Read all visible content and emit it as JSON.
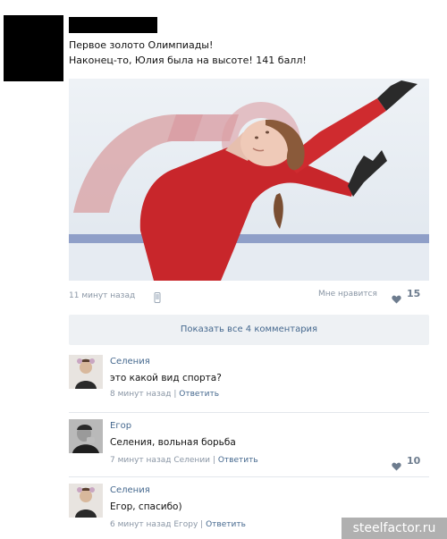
{
  "post": {
    "text_line1": "Первое золото Олимпиады!",
    "text_line2": "Наконец-то, Юлия была на высоте! 141 балл!",
    "time": "11 минут назад",
    "like_label": "Мне нравится",
    "like_count": "15",
    "photo_icon": "figure-skater-photo"
  },
  "show_comments": {
    "label": "Показать все 4 комментария"
  },
  "comments": [
    {
      "author": "Селения",
      "text": "это какой вид спорта?",
      "time": "8 минут назад",
      "separator": "|",
      "reply": "Ответить",
      "likes": ""
    },
    {
      "author": "Егор",
      "text": "Селения, вольная борьба",
      "time": "7 минут назад Селении",
      "separator": "|",
      "reply": "Ответить",
      "likes": "10"
    },
    {
      "author": "Селения",
      "text": "Егор, спасибо)",
      "time": "6 минут назад Егору",
      "separator": "|",
      "reply": "Ответить",
      "likes": ""
    }
  ],
  "watermark": "steelfactor.ru",
  "colors": {
    "link": "#45688e",
    "meta": "#8a96a5",
    "bar": "#eef1f4",
    "heart": "#6d7c8e"
  }
}
